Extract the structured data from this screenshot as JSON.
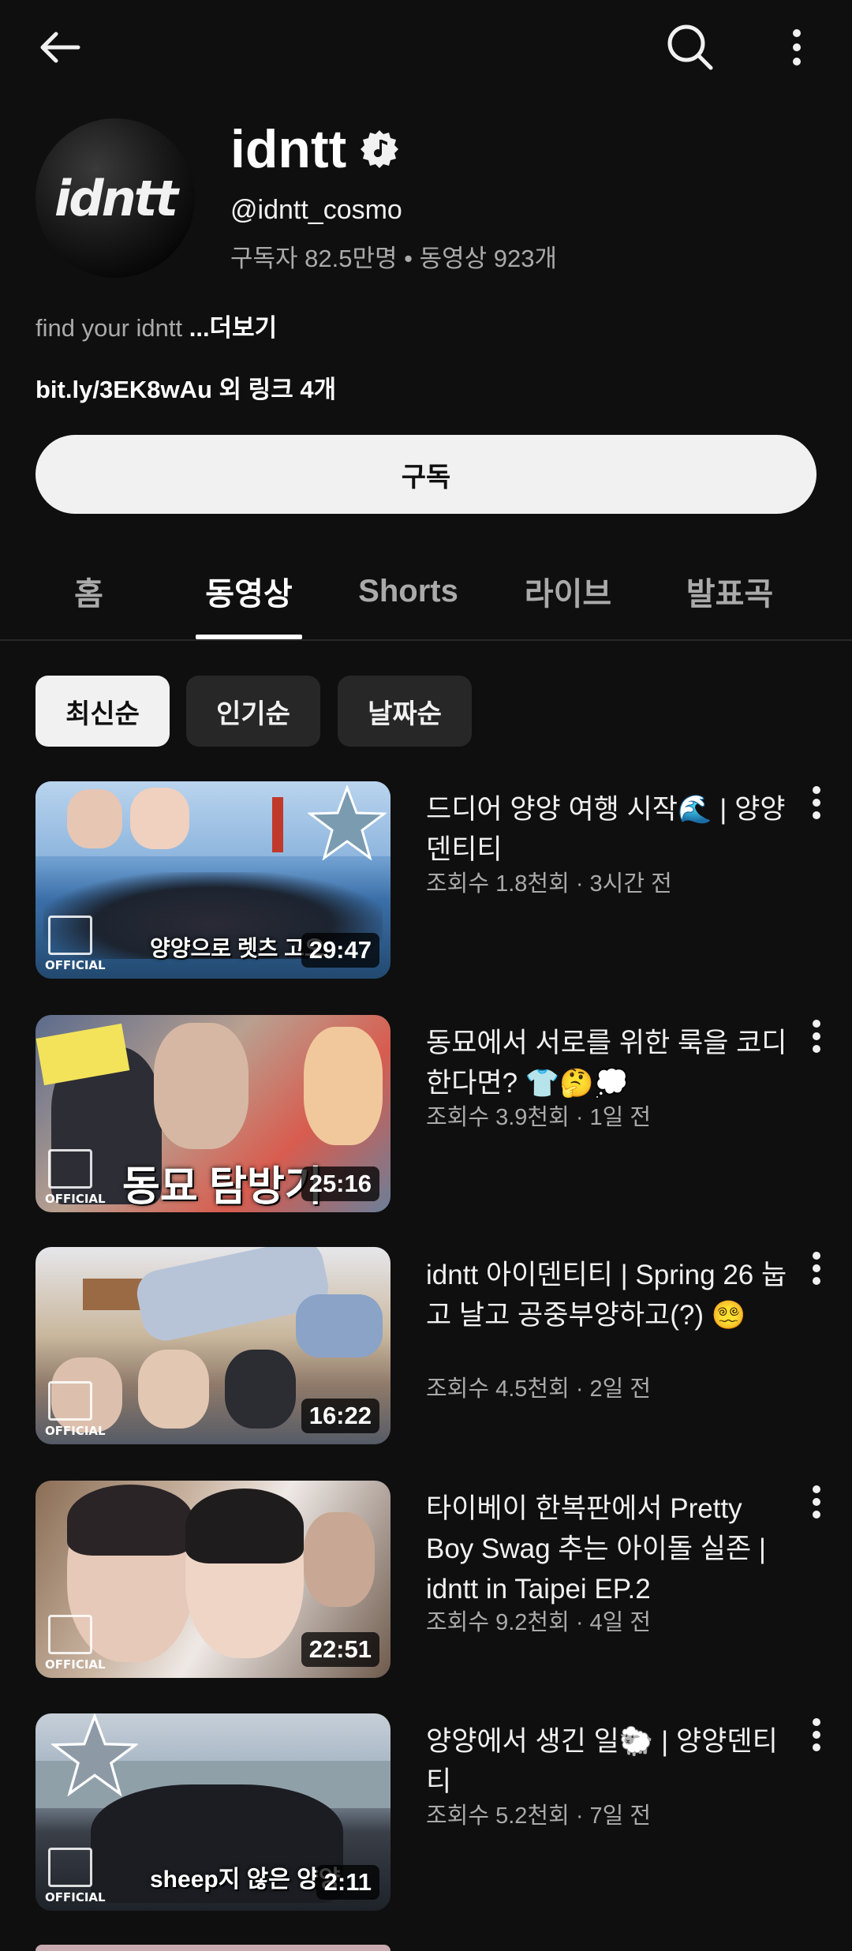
{
  "header": {
    "back_icon": "arrow-left-icon",
    "search_icon": "search-icon",
    "more_icon": "kebab-vertical-icon"
  },
  "channel": {
    "avatar_text": "idntt",
    "name": "idntt",
    "handle": "@idntt_cosmo",
    "stats": "구독자 82.5만명 • 동영상 923개",
    "description": "find your idntt ",
    "more_label": "...더보기",
    "links": "bit.ly/3EK8wAu 외 링크 4개",
    "subscribe_label": "구독"
  },
  "tabs": [
    {
      "label": "홈",
      "active": false
    },
    {
      "label": "동영상",
      "active": true
    },
    {
      "label": "Shorts",
      "active": false
    },
    {
      "label": "라이브",
      "active": false
    },
    {
      "label": "발표곡",
      "active": false
    }
  ],
  "chips": [
    {
      "label": "최신순",
      "active": true
    },
    {
      "label": "인기순",
      "active": false
    },
    {
      "label": "날짜순",
      "active": false
    }
  ],
  "videos": [
    {
      "title": "드디어 양양 여행 시작🌊 | 양양덴티티",
      "meta": "조회수 1.8천회 · 3시간 전",
      "duration": "29:47",
      "overlay": "양양으로 렛츠 고오",
      "badge": "OFFICIAL"
    },
    {
      "title": "동묘에서 서로를 위한 룩을 코디한다면? 👕🤔💭",
      "meta": "조회수 3.9천회 · 1일 전",
      "duration": "25:16",
      "overlay": "동묘 탐방기",
      "badge": "OFFICIAL"
    },
    {
      "title": "idntt 아이덴티티 | Spring 26 눕고 날고 공중부양하고(?) 😵‍💫",
      "meta": "조회수 4.5천회 · 2일 전",
      "duration": "16:22",
      "overlay": "",
      "badge": "OFFICIAL"
    },
    {
      "title": "타이베이 한복판에서 Pretty Boy Swag 추는 아이돌 실존 | idntt in Taipei EP.2",
      "meta": "조회수 9.2천회 · 4일 전",
      "duration": "22:51",
      "overlay": "",
      "badge": "OFFICIAL"
    },
    {
      "title": "양양에서 생긴 일🐑 | 양양덴티티",
      "meta": "조회수 5.2천회 · 7일 전",
      "duration": "2:11",
      "overlay": "sheep지 않은 양양",
      "badge": "OFFICIAL"
    }
  ]
}
